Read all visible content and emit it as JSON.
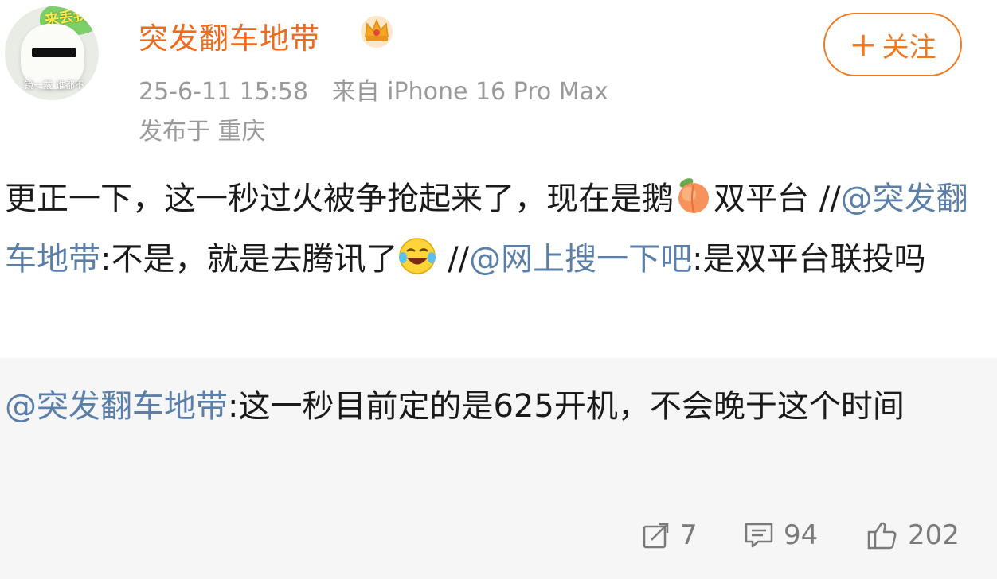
{
  "user": {
    "name": "突发翻车地带",
    "avatar_caption": "镜一戴 谁都不",
    "avatar_sticker": "来丢我"
  },
  "meta": {
    "time": "25-6-11 15:58",
    "source": "来自 iPhone 16 Pro Max",
    "location": "发布于 重庆"
  },
  "follow": {
    "plus": "+",
    "label": "关注"
  },
  "post": {
    "part1": "更正一下，这一秒过火被争抢起来了，现在是鹅",
    "part2": "双平台 //",
    "mention1": "@突发翻车地带",
    "part3": ":不是，就是去腾讯了",
    "part4": " //",
    "mention2": "@网上搜一下吧",
    "part5": ":是双平台联投吗",
    "emoji1": "peach-icon",
    "emoji2": "laughing-tears-icon"
  },
  "quote": {
    "mention": "@突发翻车地带",
    "text": ":这一秒目前定的是625开机，不会晚于这个时间"
  },
  "actions": {
    "repost_count": "7",
    "comment_count": "94",
    "like_count": "202"
  },
  "colors": {
    "username": "#f06a1a",
    "follow": "#f07a1f",
    "mention": "#5b7fa8",
    "meta": "#9a9a9a",
    "quote_bg": "#f6f6f6"
  }
}
